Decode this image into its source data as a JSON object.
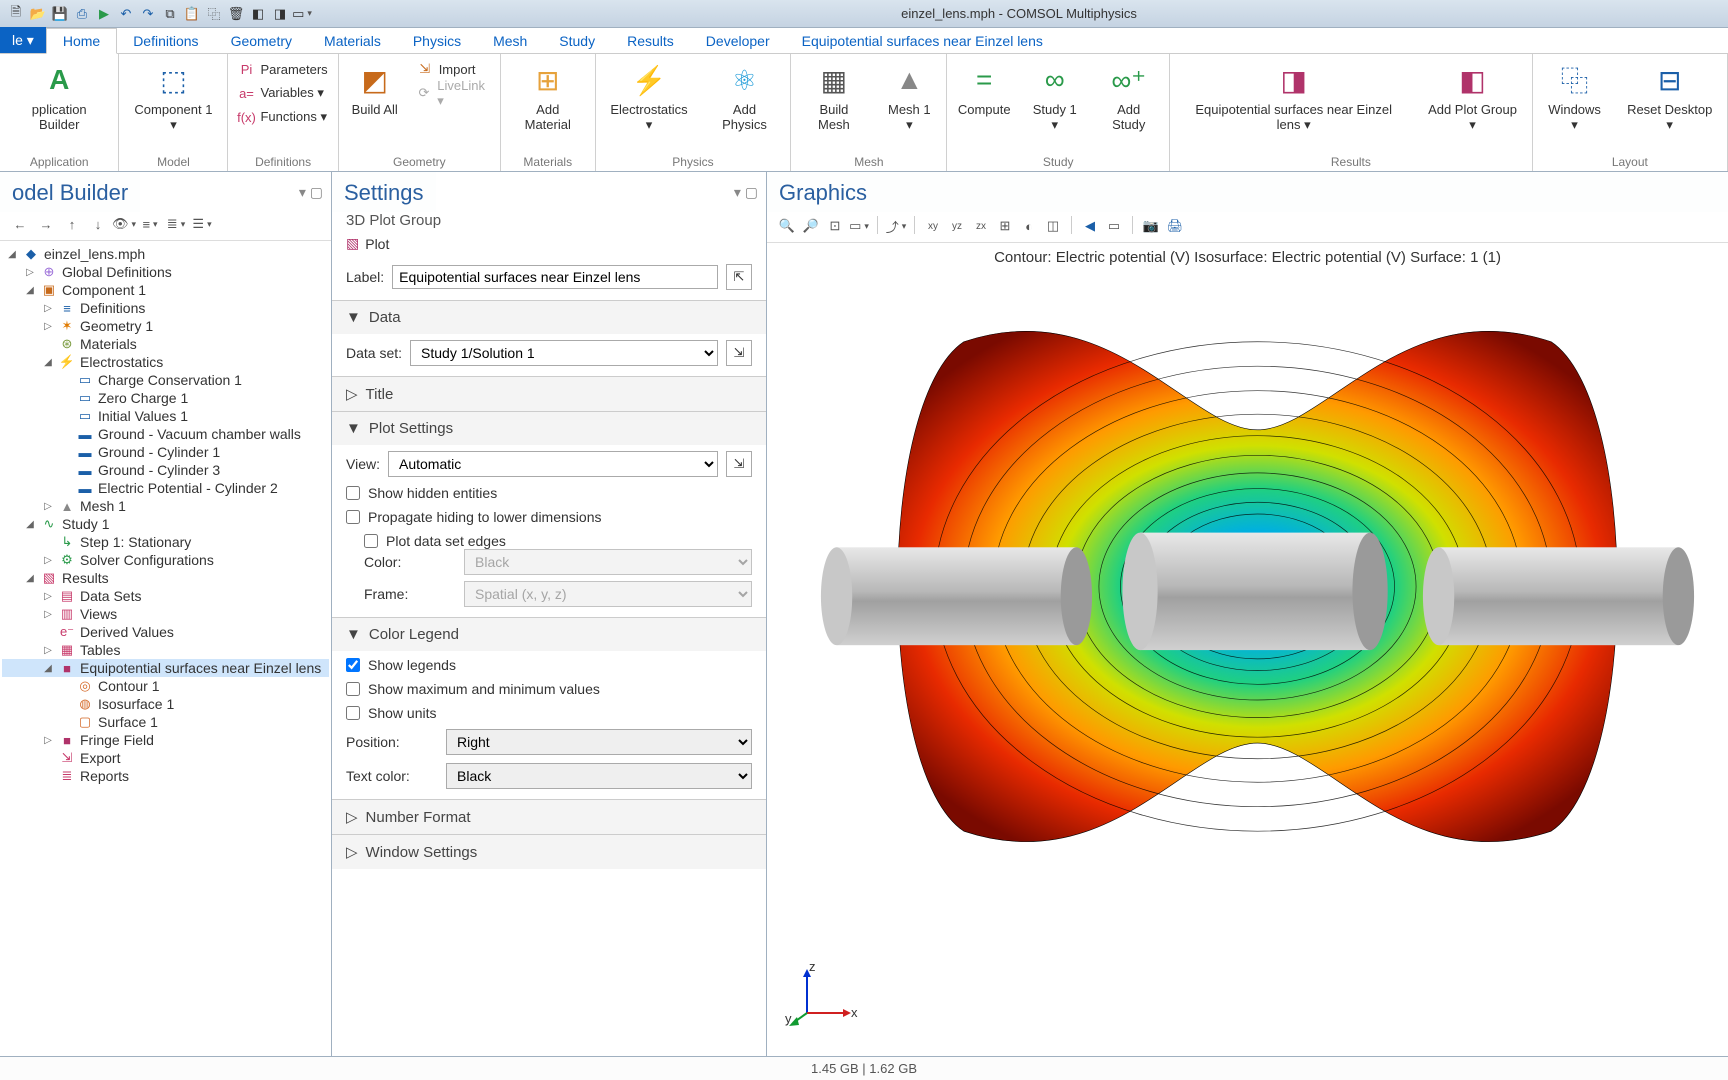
{
  "window_title": "einzel_lens.mph - COMSOL Multiphysics",
  "file_tab": "le ▾",
  "ribbon_tabs": [
    "Home",
    "Definitions",
    "Geometry",
    "Materials",
    "Physics",
    "Mesh",
    "Study",
    "Results",
    "Developer",
    "Equipotential surfaces near Einzel lens"
  ],
  "active_tab_index": 0,
  "ribbon": {
    "application": {
      "label": "Application",
      "btn": "pplication\nBuilder"
    },
    "model": {
      "label": "Model",
      "btn": "Component\n1 ▾"
    },
    "definitions": {
      "label": "Definitions",
      "params": "Parameters",
      "vars": "Variables ▾",
      "funcs": "Functions ▾"
    },
    "geometry": {
      "label": "Geometry",
      "btn": "Build\nAll",
      "import_": "Import",
      "livelink": "LiveLink ▾"
    },
    "materials": {
      "label": "Materials",
      "btn": "Add\nMaterial"
    },
    "physics": {
      "label": "Physics",
      "es": "Electrostatics\n▾",
      "add": "Add\nPhysics"
    },
    "mesh": {
      "label": "Mesh",
      "build": "Build\nMesh",
      "mesh1": "Mesh\n1 ▾"
    },
    "study": {
      "label": "Study",
      "compute": "Compute",
      "study1": "Study\n1 ▾",
      "add": "Add\nStudy"
    },
    "results": {
      "label": "Results",
      "plot": "Equipotential surfaces\nnear Einzel lens ▾",
      "group": "Add Plot\nGroup ▾"
    },
    "layout": {
      "label": "Layout",
      "windows": "Windows\n▾",
      "reset": "Reset\nDesktop ▾"
    }
  },
  "model_builder": {
    "title": "odel Builder",
    "tree": [
      {
        "d": 0,
        "tw": "◢",
        "icon": "◆",
        "color": "#1b5fa8",
        "text": "einzel_lens.mph"
      },
      {
        "d": 1,
        "tw": "▷",
        "icon": "⊕",
        "color": "#9a6cd8",
        "text": "Global Definitions"
      },
      {
        "d": 1,
        "tw": "◢",
        "icon": "▣",
        "color": "#c76a1b",
        "text": "Component 1"
      },
      {
        "d": 2,
        "tw": "▷",
        "icon": "≡",
        "color": "#1b5fa8",
        "text": "Definitions"
      },
      {
        "d": 2,
        "tw": "▷",
        "icon": "✶",
        "color": "#e07a00",
        "text": "Geometry 1"
      },
      {
        "d": 2,
        "tw": "",
        "icon": "⊛",
        "color": "#7a9b3e",
        "text": "Materials"
      },
      {
        "d": 2,
        "tw": "◢",
        "icon": "⚡",
        "color": "#1b9ad8",
        "text": "Electrostatics"
      },
      {
        "d": 3,
        "tw": "",
        "icon": "▭",
        "color": "#1b5fa8",
        "text": "Charge Conservation 1"
      },
      {
        "d": 3,
        "tw": "",
        "icon": "▭",
        "color": "#1b5fa8",
        "text": "Zero Charge 1"
      },
      {
        "d": 3,
        "tw": "",
        "icon": "▭",
        "color": "#1b5fa8",
        "text": "Initial Values 1"
      },
      {
        "d": 3,
        "tw": "",
        "icon": "▬",
        "color": "#1b5fa8",
        "text": "Ground - Vacuum chamber walls"
      },
      {
        "d": 3,
        "tw": "",
        "icon": "▬",
        "color": "#1b5fa8",
        "text": "Ground - Cylinder 1"
      },
      {
        "d": 3,
        "tw": "",
        "icon": "▬",
        "color": "#1b5fa8",
        "text": "Ground - Cylinder 3"
      },
      {
        "d": 3,
        "tw": "",
        "icon": "▬",
        "color": "#1b5fa8",
        "text": "Electric Potential - Cylinder 2"
      },
      {
        "d": 2,
        "tw": "▷",
        "icon": "▲",
        "color": "#888",
        "text": "Mesh 1"
      },
      {
        "d": 1,
        "tw": "◢",
        "icon": "∿",
        "color": "#2a9a4a",
        "text": "Study 1"
      },
      {
        "d": 2,
        "tw": "",
        "icon": "↳",
        "color": "#2a9a4a",
        "text": "Step 1: Stationary"
      },
      {
        "d": 2,
        "tw": "▷",
        "icon": "⚙",
        "color": "#2a9a4a",
        "text": "Solver Configurations"
      },
      {
        "d": 1,
        "tw": "◢",
        "icon": "▧",
        "color": "#c73a6a",
        "text": "Results"
      },
      {
        "d": 2,
        "tw": "▷",
        "icon": "▤",
        "color": "#c73a6a",
        "text": "Data Sets"
      },
      {
        "d": 2,
        "tw": "▷",
        "icon": "▥",
        "color": "#c73a6a",
        "text": "Views"
      },
      {
        "d": 2,
        "tw": "",
        "icon": "e⁻",
        "color": "#c73a6a",
        "text": "Derived Values"
      },
      {
        "d": 2,
        "tw": "▷",
        "icon": "▦",
        "color": "#c73a6a",
        "text": "Tables"
      },
      {
        "d": 2,
        "tw": "◢",
        "icon": "■",
        "color": "#b0336a",
        "text": "Equipotential surfaces near Einzel lens",
        "sel": true
      },
      {
        "d": 3,
        "tw": "",
        "icon": "◎",
        "color": "#d46a2a",
        "text": "Contour 1"
      },
      {
        "d": 3,
        "tw": "",
        "icon": "◍",
        "color": "#d46a2a",
        "text": "Isosurface 1"
      },
      {
        "d": 3,
        "tw": "",
        "icon": "▢",
        "color": "#d46a2a",
        "text": "Surface 1"
      },
      {
        "d": 2,
        "tw": "▷",
        "icon": "■",
        "color": "#b0336a",
        "text": "Fringe Field"
      },
      {
        "d": 2,
        "tw": "",
        "icon": "⇲",
        "color": "#c73a6a",
        "text": "Export"
      },
      {
        "d": 2,
        "tw": "",
        "icon": "≣",
        "color": "#c73a6a",
        "text": "Reports"
      }
    ]
  },
  "settings": {
    "title": "Settings",
    "subtitle": "3D Plot Group",
    "plot_btn": "Plot",
    "label_label": "Label:",
    "label_value": "Equipotential surfaces near Einzel lens",
    "sec_data": "Data",
    "dataset_label": "Data set:",
    "dataset_value": "Study 1/Solution 1",
    "sec_title": "Title",
    "sec_plotsettings": "Plot Settings",
    "view_label": "View:",
    "view_value": "Automatic",
    "chk_hidden": "Show hidden entities",
    "chk_propagate": "Propagate hiding to lower dimensions",
    "chk_edges": "Plot data set edges",
    "color_label": "Color:",
    "color_value": "Black",
    "frame_label": "Frame:",
    "frame_value": "Spatial  (x, y, z)",
    "sec_legend": "Color Legend",
    "chk_legends": "Show legends",
    "chk_maxmin": "Show maximum and minimum values",
    "chk_units": "Show units",
    "position_label": "Position:",
    "position_value": "Right",
    "textcolor_label": "Text color:",
    "textcolor_value": "Black",
    "sec_number": "Number Format",
    "sec_window": "Window Settings"
  },
  "graphics": {
    "title": "Graphics",
    "caption": "Contour: Electric potential (V)   Isosurface: Electric potential (V)   Surface: 1 (1)",
    "axes": {
      "z": "z",
      "y": "y",
      "x": "x"
    }
  },
  "status": "1.45 GB | 1.62 GB"
}
